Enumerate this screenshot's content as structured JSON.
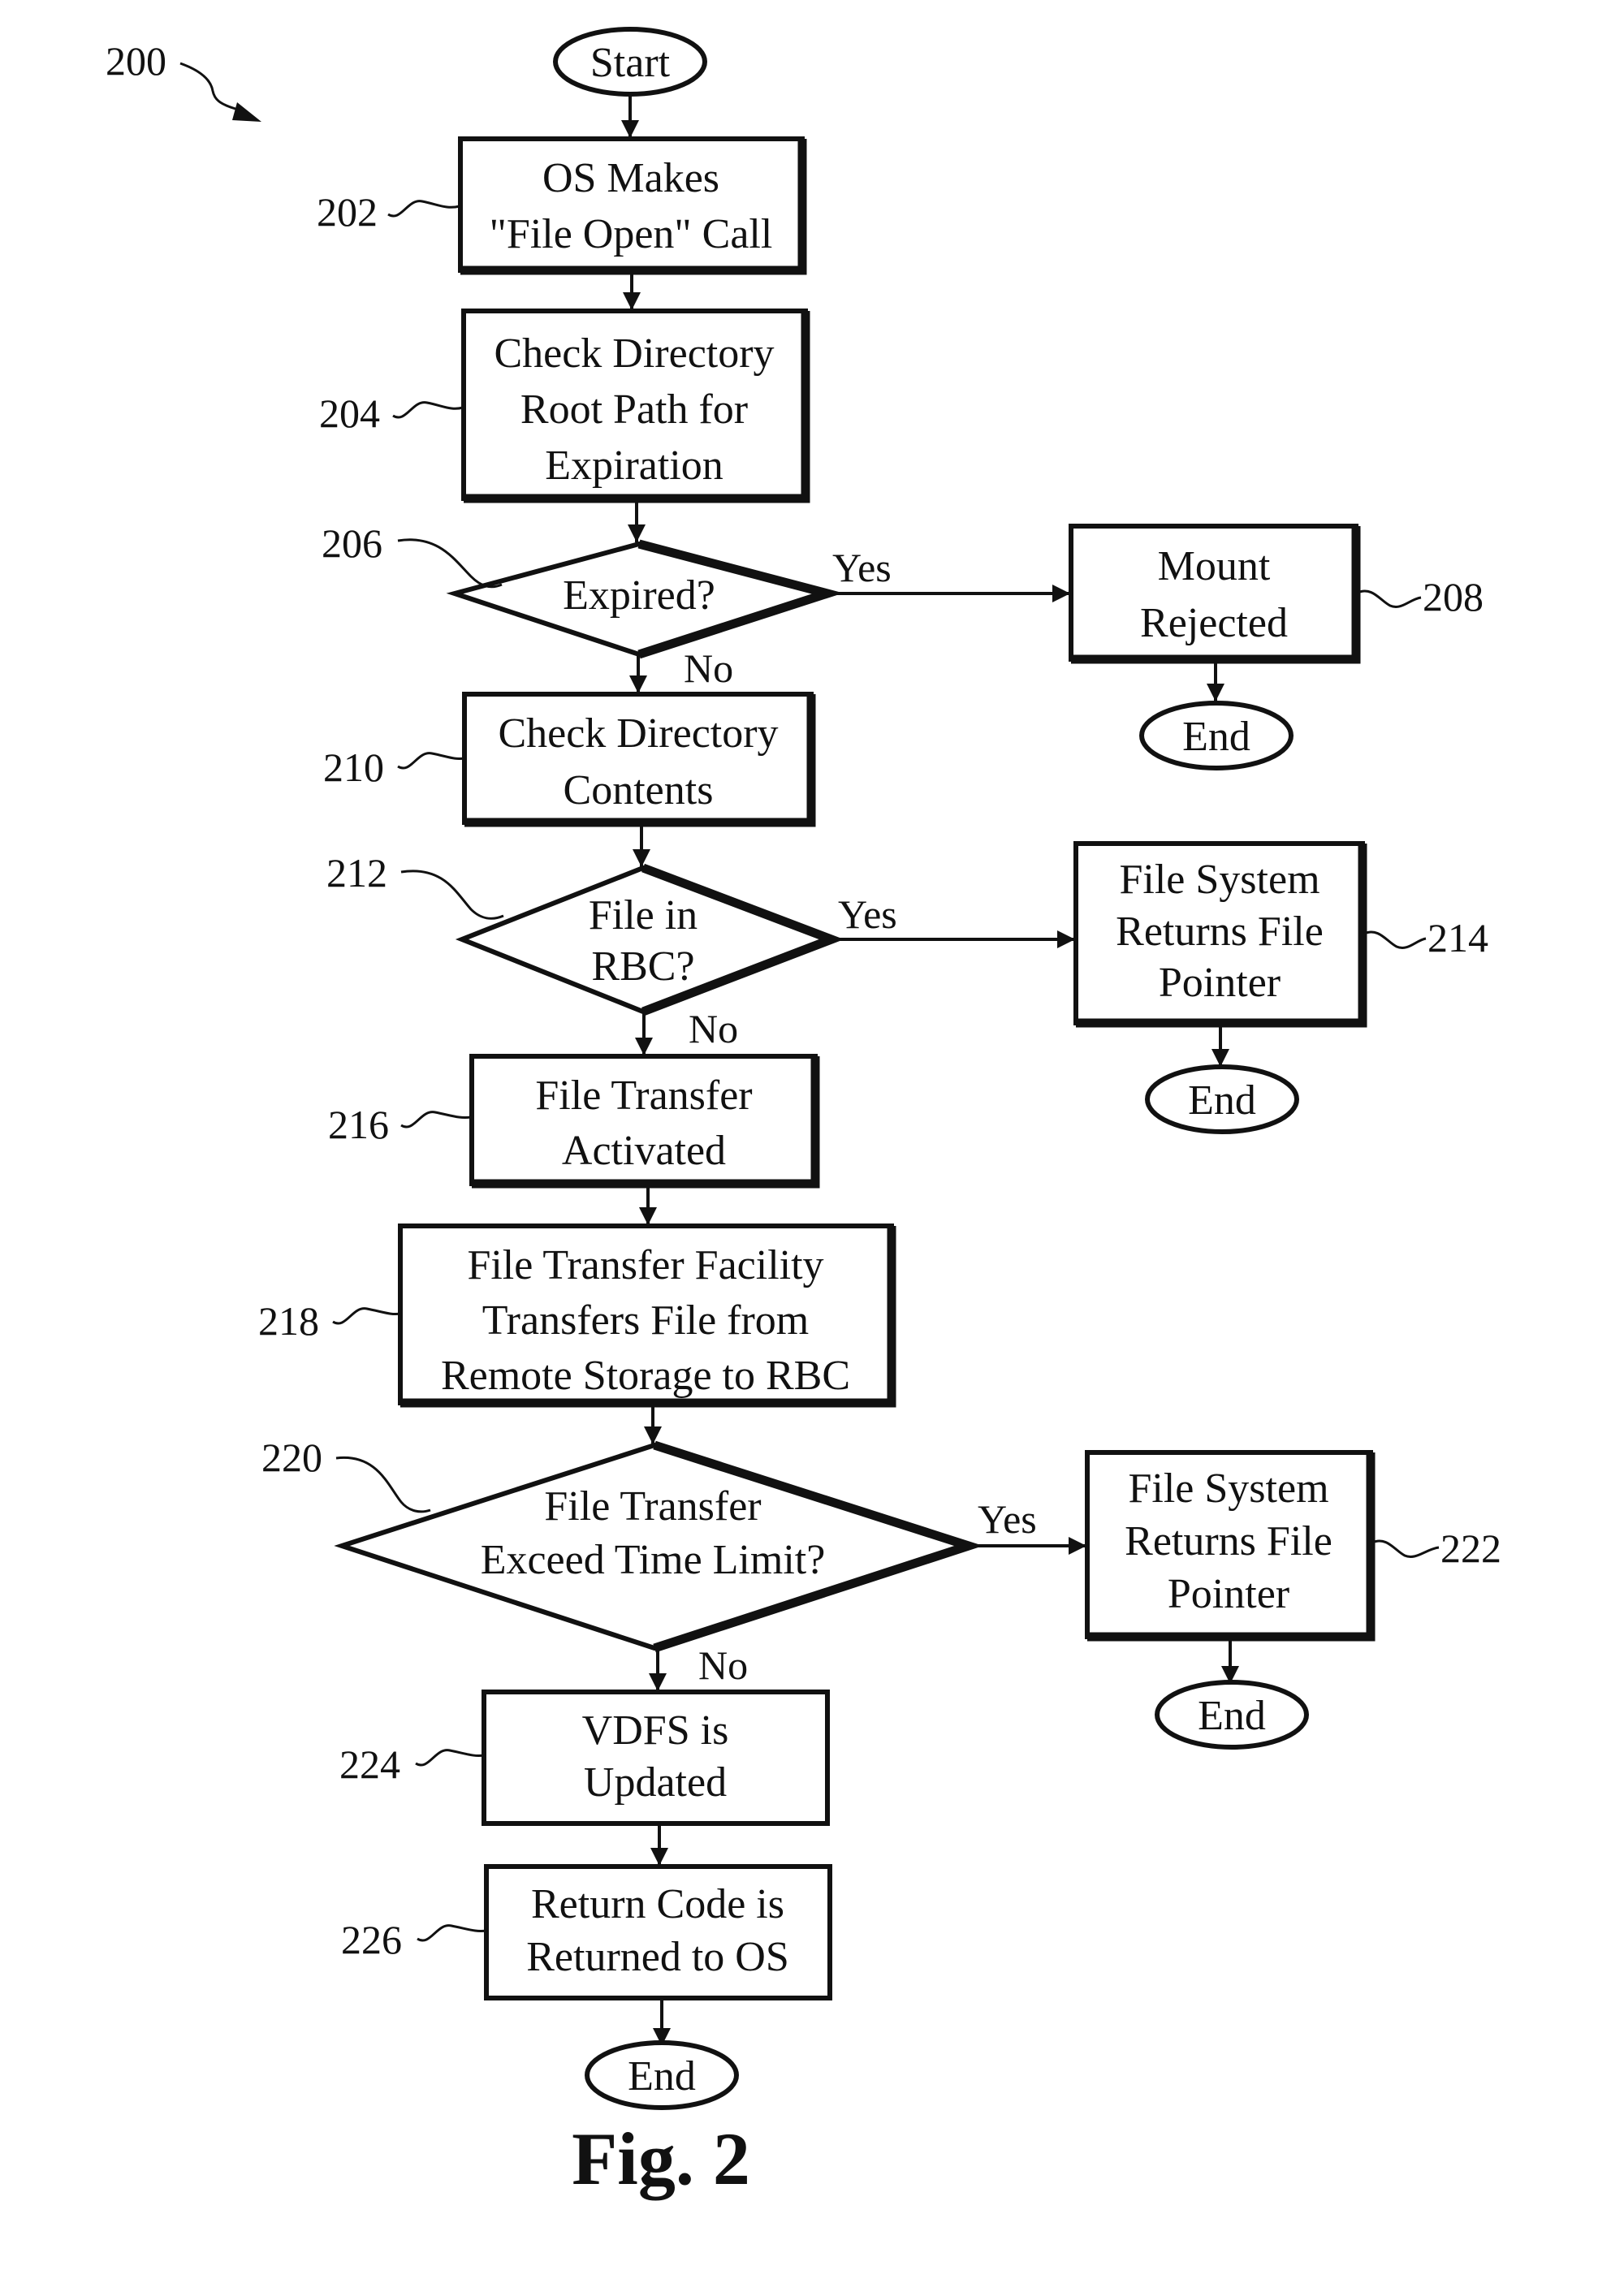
{
  "figure": {
    "reference": "200",
    "caption": "Fig. 2"
  },
  "nodes": {
    "start": {
      "ref": "",
      "lines": [
        "Start"
      ]
    },
    "n202": {
      "ref": "202",
      "lines": [
        "OS Makes",
        "\"File Open\" Call"
      ]
    },
    "n204": {
      "ref": "204",
      "lines": [
        "Check Directory",
        "Root Path for",
        "Expiration"
      ]
    },
    "n206": {
      "ref": "206",
      "lines": [
        "Expired?"
      ]
    },
    "n208": {
      "ref": "208",
      "lines": [
        "Mount",
        "Rejected"
      ]
    },
    "end208": {
      "ref": "",
      "lines": [
        "End"
      ]
    },
    "n210": {
      "ref": "210",
      "lines": [
        "Check Directory",
        "Contents"
      ]
    },
    "n212": {
      "ref": "212",
      "lines": [
        "File in",
        "RBC?"
      ]
    },
    "n214": {
      "ref": "214",
      "lines": [
        "File System",
        "Returns File",
        "Pointer"
      ]
    },
    "end214": {
      "ref": "",
      "lines": [
        "End"
      ]
    },
    "n216": {
      "ref": "216",
      "lines": [
        "File Transfer",
        "Activated"
      ]
    },
    "n218": {
      "ref": "218",
      "lines": [
        "File Transfer Facility",
        "Transfers File from",
        "Remote Storage to RBC"
      ]
    },
    "n220": {
      "ref": "220",
      "lines": [
        "File Transfer",
        "Exceed Time Limit?"
      ]
    },
    "n222": {
      "ref": "222",
      "lines": [
        "File System",
        "Returns File",
        "Pointer"
      ]
    },
    "end222": {
      "ref": "",
      "lines": [
        "End"
      ]
    },
    "n224": {
      "ref": "224",
      "lines": [
        "VDFS is",
        "Updated"
      ]
    },
    "n226": {
      "ref": "226",
      "lines": [
        "Return Code is",
        "Returned to OS"
      ]
    },
    "end226": {
      "ref": "",
      "lines": [
        "End"
      ]
    }
  },
  "edges": {
    "e206_yes": "Yes",
    "e206_no": "No",
    "e212_yes": "Yes",
    "e212_no": "No",
    "e220_yes": "Yes",
    "e220_no": "No"
  }
}
